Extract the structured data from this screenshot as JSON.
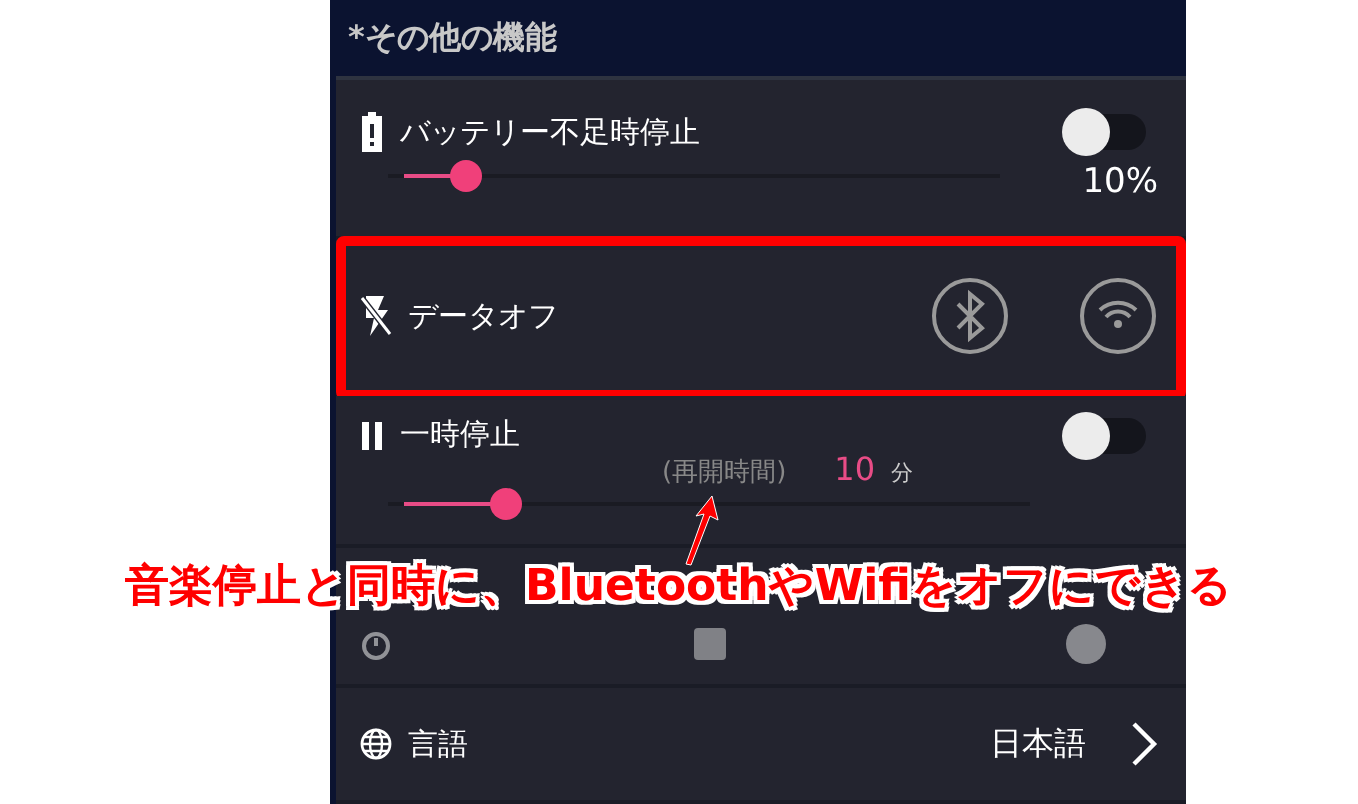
{
  "section": {
    "title": "*その他の機能"
  },
  "rows": [
    {
      "kind": "battery",
      "label": "バッテリー不足時停止",
      "on": false,
      "level": 0.1,
      "reading": "10%",
      "highlighted": false
    },
    {
      "kind": "data_off",
      "label": "データオフ",
      "highlighted": true
    },
    {
      "kind": "pause",
      "label": "一時停止",
      "hint": "(再開時間)",
      "value": "10",
      "unit": "分",
      "on": false,
      "level": 0.16,
      "highlighted": false
    },
    {
      "kind": "timer",
      "disabled": true,
      "highlighted": false
    },
    {
      "kind": "language",
      "label": "言語",
      "value": "日本語",
      "highlighted": false
    }
  ],
  "annotation": {
    "caption": "音楽停止と同時に、BluetoothやWifiをオフにできる"
  }
}
